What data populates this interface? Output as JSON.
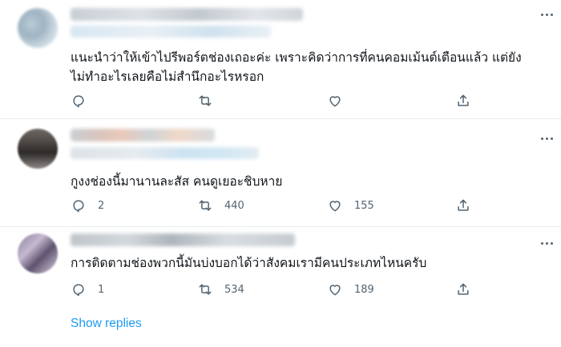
{
  "tweets": [
    {
      "text_line1": "แนะนำว่าให้เข้าไปรีพอร์ตช่องเถอะค่ะ เพราะคิดว่าการที่คนคอมเม้นต์เตือนแล้ว แต่ยัง",
      "text_line2": "ไม่ทำอะไรเลยคือไม่สำนึกอะไรหรอก",
      "reply_count": "",
      "retweet_count": "",
      "like_count": ""
    },
    {
      "text_line1": "กูงงช่องนี้มานานละสัส คนดูเยอะชิบหาย",
      "reply_count": "2",
      "retweet_count": "440",
      "like_count": "155"
    },
    {
      "text_line1": "การติดตามช่องพวกนี้มันบ่งบอกได้ว่าสังคมเรามีคนประเภทไหนครับ",
      "reply_count": "1",
      "retweet_count": "534",
      "like_count": "189"
    }
  ],
  "show_replies_label": "Show replies",
  "colors": {
    "accent": "#1d9bf0",
    "icon": "#536471",
    "text": "#0f1419",
    "divider": "#e6ecf0"
  },
  "icons": [
    "reply-icon",
    "retweet-icon",
    "like-icon",
    "share-icon",
    "more-icon"
  ]
}
